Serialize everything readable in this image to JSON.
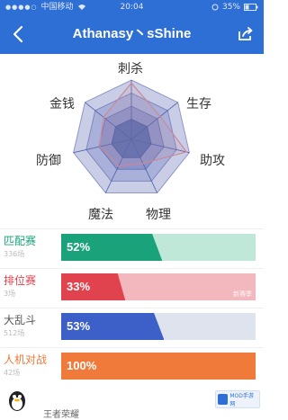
{
  "statusbar": {
    "carrier": "中国移动",
    "time": "20:04",
    "battery": "35%"
  },
  "navbar": {
    "title": "Athanasy丶sShine",
    "back_icon": "back-chevron-icon",
    "share_icon": "share-icon"
  },
  "radar": {
    "axes": [
      "刺杀",
      "生存",
      "助攻",
      "物理",
      "魔法",
      "防御",
      "金钱"
    ],
    "fill_color": "#5b6fb3",
    "outline_color": "#c98a9a"
  },
  "modes": [
    {
      "name": "匹配赛",
      "count": "336场",
      "percent_label": "52%",
      "percent": 52,
      "color": "#1aa37a",
      "track": "#bfe8d9",
      "name_color": "#1aa37a"
    },
    {
      "name": "排位赛",
      "count": "3场",
      "percent_label": "33%",
      "percent": 33,
      "color": "#e0424e",
      "track": "#f3b8be",
      "name_color": "#e0424e",
      "tag": "新赛季"
    },
    {
      "name": "大乱斗",
      "count": "512场",
      "percent_label": "53%",
      "percent": 53,
      "color": "#3c5fc8",
      "track": "#dfe3ee",
      "name_color": "#555555"
    },
    {
      "name": "人机对战",
      "count": "42场",
      "percent_label": "100%",
      "percent": 100,
      "color": "#f07a3a",
      "track": "#f9c7a6",
      "name_color": "#f07a3a"
    }
  ],
  "bottom": {
    "text": "王者荣耀",
    "icon": "qq-penguin-icon"
  },
  "watermark": {
    "text": "MOD手游网"
  }
}
